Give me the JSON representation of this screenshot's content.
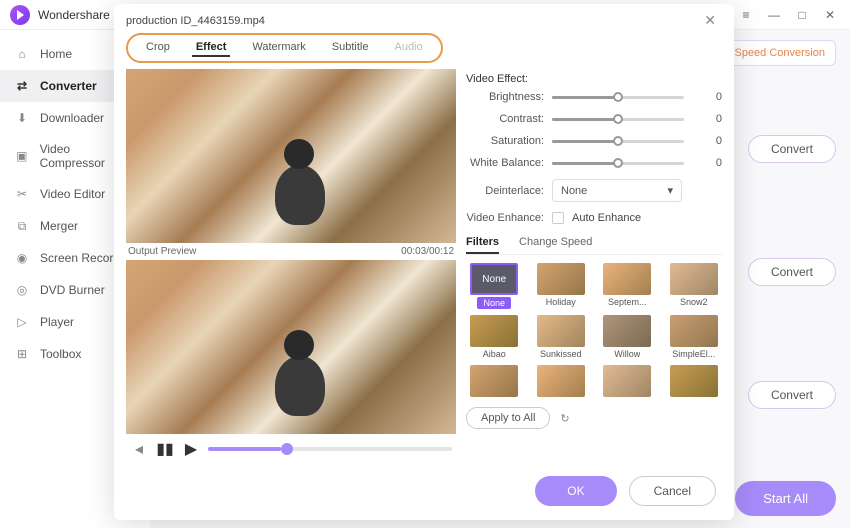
{
  "app": {
    "title": "Wondershare"
  },
  "window_controls": {
    "menu": "≡",
    "min": "—",
    "max": "□",
    "close": "✕"
  },
  "sidebar": {
    "items": [
      {
        "label": "Home",
        "icon": "home-icon"
      },
      {
        "label": "Converter",
        "icon": "converter-icon"
      },
      {
        "label": "Downloader",
        "icon": "downloader-icon"
      },
      {
        "label": "Video Compressor",
        "icon": "compress-icon"
      },
      {
        "label": "Video Editor",
        "icon": "editor-icon"
      },
      {
        "label": "Merger",
        "icon": "merger-icon"
      },
      {
        "label": "Screen Recorder",
        "icon": "recorder-icon"
      },
      {
        "label": "DVD Burner",
        "icon": "dvd-icon"
      },
      {
        "label": "Player",
        "icon": "player-icon"
      },
      {
        "label": "Toolbox",
        "icon": "toolbox-icon"
      }
    ],
    "active_index": 1
  },
  "main": {
    "top_button": "Speed Conversion",
    "convert_button": "Convert",
    "start_all": "Start All"
  },
  "modal": {
    "filename": "production ID_4463159.mp4",
    "close": "✕",
    "tabs": [
      "Crop",
      "Effect",
      "Watermark",
      "Subtitle",
      "Audio"
    ],
    "active_tab": 1,
    "disabled_tab": 4,
    "preview": {
      "output_label": "Output Preview",
      "time": "00:03/00:12"
    },
    "effect": {
      "section_title": "Video Effect:",
      "sliders": [
        {
          "label": "Brightness:",
          "value": "0"
        },
        {
          "label": "Contrast:",
          "value": "0"
        },
        {
          "label": "Saturation:",
          "value": "0"
        },
        {
          "label": "White Balance:",
          "value": "0"
        }
      ],
      "deinterlace_label": "Deinterlace:",
      "deinterlace_value": "None",
      "enhance_label": "Video Enhance:",
      "auto_enhance": "Auto Enhance"
    },
    "subtabs": [
      "Filters",
      "Change Speed"
    ],
    "active_subtab": 0,
    "filters": [
      {
        "name": "None",
        "selected": true,
        "cls": "none"
      },
      {
        "name": "Holiday",
        "cls": "f-holiday"
      },
      {
        "name": "Septem...",
        "cls": "f-sept"
      },
      {
        "name": "Snow2",
        "cls": "f-snow"
      },
      {
        "name": "Aibao",
        "cls": "f-aibao"
      },
      {
        "name": "Sunkissed",
        "cls": "f-sun"
      },
      {
        "name": "Willow",
        "cls": "f-willow"
      },
      {
        "name": "SimpleEl...",
        "cls": "f-simple"
      },
      {
        "name": "",
        "cls": "f-holiday"
      },
      {
        "name": "",
        "cls": "f-sept"
      },
      {
        "name": "",
        "cls": "f-snow"
      },
      {
        "name": "",
        "cls": "f-aibao"
      }
    ],
    "apply_all": "Apply to All",
    "ok": "OK",
    "cancel": "Cancel"
  }
}
